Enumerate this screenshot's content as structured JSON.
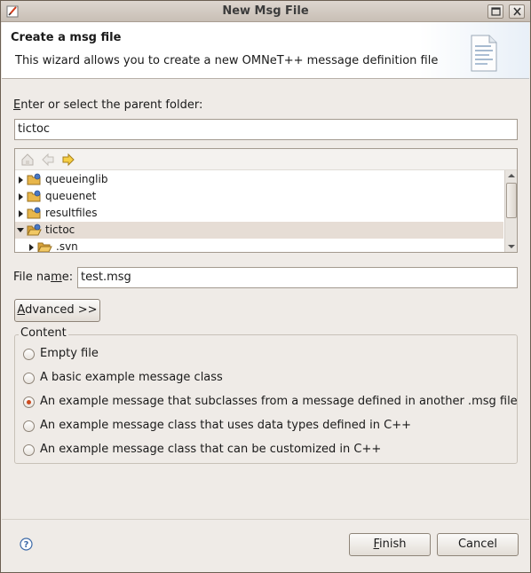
{
  "window": {
    "title": "New Msg File"
  },
  "header": {
    "title": "Create a msg file",
    "description": "This wizard allows you to create a new OMNeT++ message definition file"
  },
  "folder": {
    "label_mn": "E",
    "label_rest": "nter or select the parent folder:",
    "value": "tictoc"
  },
  "tree": {
    "items": [
      {
        "label": "queueinglib",
        "expanded": false,
        "selected": false
      },
      {
        "label": "queuenet",
        "expanded": false,
        "selected": false
      },
      {
        "label": "resultfiles",
        "expanded": false,
        "selected": false
      },
      {
        "label": "tictoc",
        "expanded": true,
        "selected": true
      },
      {
        "label": ".svn",
        "expanded": false,
        "selected": false
      }
    ]
  },
  "filename": {
    "label_pre": "File na",
    "label_mn": "m",
    "label_post": "e:",
    "value": "test.msg"
  },
  "advanced": {
    "label_mn": "A",
    "label_rest": "dvanced >>"
  },
  "content": {
    "group_label": "Content",
    "options": [
      {
        "label": "Empty file",
        "checked": false
      },
      {
        "label": "A basic example message class",
        "checked": false
      },
      {
        "label": "An example message that subclasses from a message defined in another .msg file",
        "checked": true
      },
      {
        "label": "An example message class that uses data types defined in C++",
        "checked": false
      },
      {
        "label": "An example message class that can be customized in C++",
        "checked": false
      }
    ]
  },
  "footer": {
    "finish_mn": "F",
    "finish_rest": "inish",
    "cancel": "Cancel"
  },
  "colors": {
    "radio_accent": "#cc4a1e",
    "selection": "#e6ddd5",
    "folder_yellow": "#e8b64a"
  }
}
